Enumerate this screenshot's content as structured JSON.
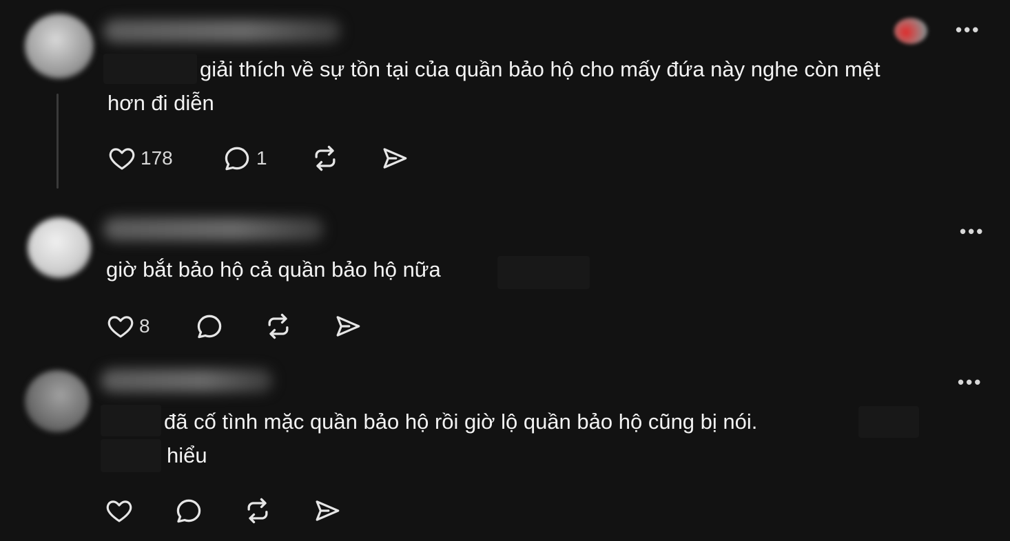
{
  "posts": [
    {
      "text_line1": "giải thích về sự tồn tại của quần bảo hộ cho mấy đứa này nghe còn mệt",
      "text_line2": "hơn đi diễn",
      "like_count": "178",
      "reply_count": "1",
      "more_label": "•••"
    },
    {
      "text_line1": "giờ bắt bảo hộ cả quần bảo hộ nữa",
      "like_count": "8",
      "reply_count": "",
      "more_label": "•••"
    },
    {
      "text_line1": "đã cố tình mặc quần bảo hộ rồi giờ lộ quần bảo hộ cũng bị nói.",
      "text_line2": "hiểu",
      "like_count": "",
      "reply_count": "",
      "more_label": "•••"
    }
  ],
  "icons": {
    "like": "heart-icon",
    "reply": "comment-icon",
    "repost": "repost-icon",
    "share": "send-icon",
    "more": "more-icon"
  },
  "colors": {
    "background": "#121212",
    "text": "#f3f3f3",
    "icon": "#e6e6e6",
    "thread_line": "#3a3a3a"
  }
}
